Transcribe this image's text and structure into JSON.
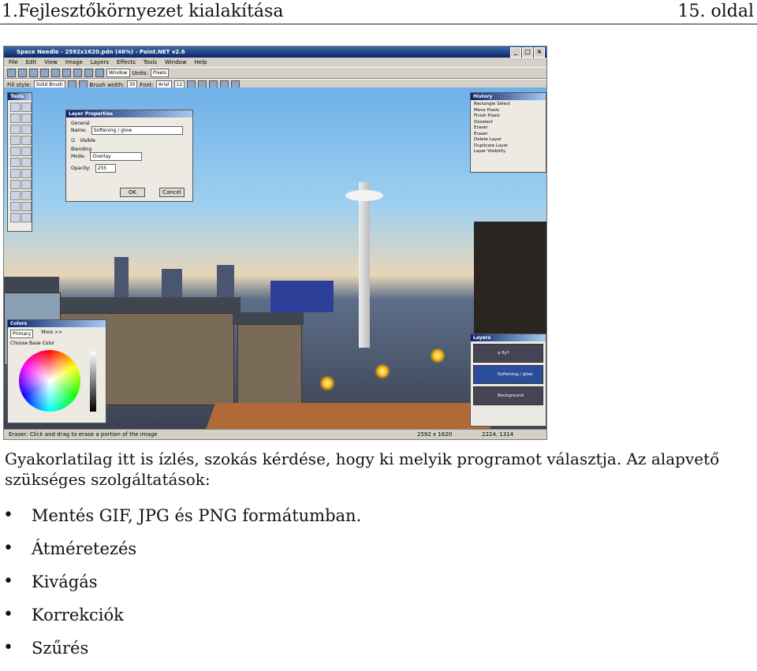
{
  "header": {
    "left": "1.Fejlesztőkörnyezet kialakítása",
    "right": "15. oldal"
  },
  "screenshot": {
    "title": "Space Needle - 2592x1620.pdn (46%) - Paint.NET v2.6",
    "menu": [
      "File",
      "Edit",
      "View",
      "Image",
      "Layers",
      "Effects",
      "Tools",
      "Window",
      "Help"
    ],
    "toolbar": {
      "window_label": "Window",
      "units_label": "Units:",
      "units_value": "Pixels",
      "fill_label": "Fill style:",
      "fill_value": "Solid Brush",
      "brush_label": "Brush width:",
      "brush_value": "30",
      "font_label": "Font:",
      "font_value": "Arial",
      "size_value": "12"
    },
    "tools_title": "Tools",
    "dialog": {
      "title": "Layer Properties",
      "general": "General",
      "name_label": "Name:",
      "name_value": "Softening / glow",
      "visible": "Visible",
      "blending": "Blending",
      "mode_label": "Mode:",
      "mode_value": "Overlay",
      "opacity_label": "Opacity:",
      "opacity_value": "255",
      "ok": "OK",
      "cancel": "Cancel"
    },
    "history": {
      "title": "History",
      "items": [
        "Rectangle Select",
        "Move Pixels",
        "Finish Pixels",
        "Deselect",
        "Eraser",
        "Eraser",
        "Delete Layer",
        "Duplicate Layer",
        "Layer Visibility"
      ]
    },
    "colors": {
      "title": "Colors",
      "select": "Primary",
      "more": "More >>",
      "choose": "Choose Base Color"
    },
    "layers": {
      "title": "Layers",
      "rows": [
        "a fly?",
        "Softening / glow",
        "Background"
      ]
    },
    "status": {
      "text": "Eraser: Click and drag to erase a portion of the image",
      "size": "2592 x 1620",
      "coords": "2224, 1314"
    }
  },
  "body": {
    "paragraph": "Gyakorlatilag itt is ízlés, szokás kérdése, hogy ki melyik programot választja. Az alapvető szükséges szolgáltatások:",
    "bullets": [
      "Mentés GIF, JPG és PNG formátumban.",
      "Átméretezés",
      "Kivágás",
      "Korrekciók",
      "Szűrés"
    ]
  }
}
